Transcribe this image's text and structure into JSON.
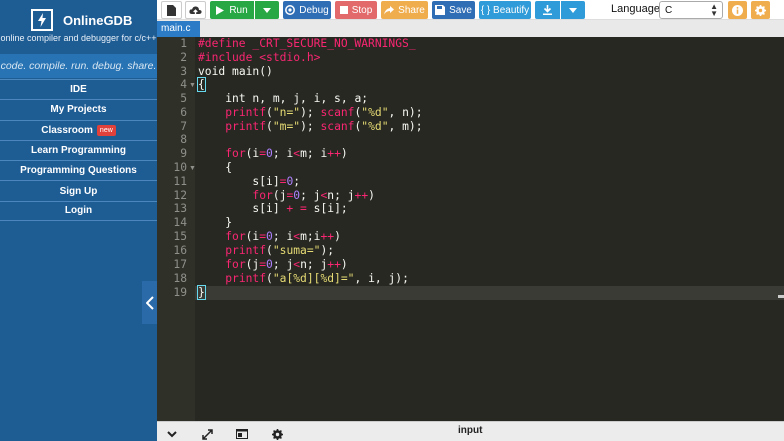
{
  "sidebar": {
    "brand": "OnlineGDB",
    "tagline": "online compiler and debugger for c/c++",
    "motto": "code. compile. run. debug. share.",
    "nav": [
      {
        "label": "IDE"
      },
      {
        "label": "My Projects"
      },
      {
        "label": "Classroom",
        "badge": "new"
      },
      {
        "label": "Learn Programming"
      },
      {
        "label": "Programming Questions"
      },
      {
        "label": "Sign Up"
      },
      {
        "label": "Login"
      }
    ]
  },
  "toolbar": {
    "run_label": "Run",
    "debug_label": "Debug",
    "stop_label": "Stop",
    "share_label": "Share",
    "save_label": "Save",
    "beautify_label": "{ } Beautify",
    "language_label": "Language",
    "language_value": "C"
  },
  "tabs": [
    {
      "label": "main.c"
    }
  ],
  "editor": {
    "line_numbers": [
      "1",
      "2",
      "3",
      "4",
      "5",
      "6",
      "7",
      "8",
      "9",
      "10",
      "11",
      "12",
      "13",
      "14",
      "15",
      "16",
      "17",
      "18",
      "19"
    ]
  },
  "bottom": {
    "input_label": "input"
  },
  "colors": {
    "sidebar": "#1e5c94",
    "run": "#28a745",
    "debug": "#2f6db5",
    "stop": "#e36a6a",
    "share": "#f0ad4e",
    "save": "#2f6db5",
    "beautify": "#2f9bd8",
    "download": "#2f9bd8",
    "info": "#f0ad4e",
    "settings": "#f0ad4e"
  }
}
